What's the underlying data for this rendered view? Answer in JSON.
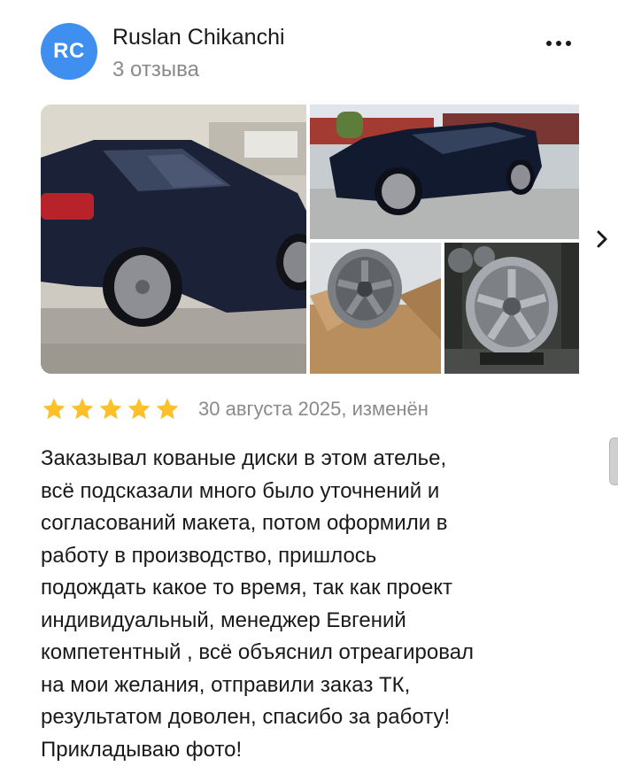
{
  "author": {
    "initials": "RC",
    "name": "Ruslan Chikanchi",
    "reviews_count": "3 отзыва",
    "avatar_color": "#3f8ff0"
  },
  "menu": {
    "icon": "more-horizontal-icon"
  },
  "photos": [
    {
      "name": "photo-car-rear",
      "subject": "dark blue SUV rear view with silver rims"
    },
    {
      "name": "photo-car-side",
      "subject": "dark blue SUV side view in parking lot"
    },
    {
      "name": "photo-wheel-box",
      "subject": "forged wheel in cardboard box"
    },
    {
      "name": "photo-wheel-display",
      "subject": "forged wheel on display stand"
    }
  ],
  "gallery_next_icon": "chevron-right-icon",
  "review": {
    "rating": 5,
    "star_color": "#fcc02d",
    "date": "30 августа 2025, изменён",
    "text": "Заказывал кованые диски в этом ателье,\nвсё подсказали много было уточнений и\nсогласований макета, потом оформили в\nработу в производство, пришлось\nподождать какое то время, так как проект\nиндивидуальный, менеджер Евгений\nкомпетентный , всё объяснил отреагировал\nна мои желания, отправили заказ ТК,\nрезультатом доволен, спасибо за работу!\nПрикладываю фото!"
  }
}
